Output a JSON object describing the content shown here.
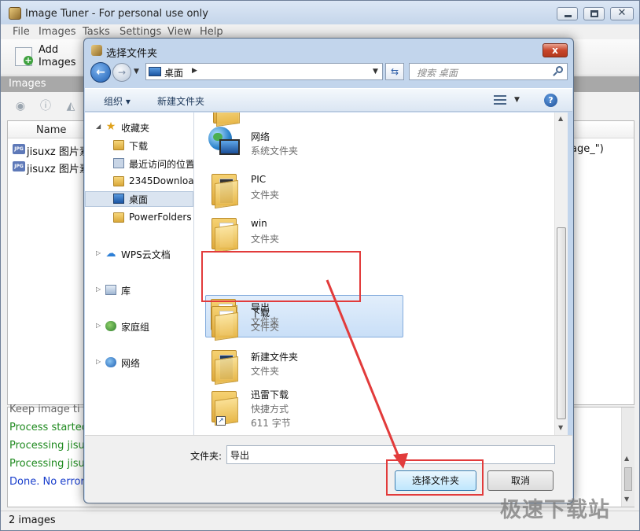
{
  "main_window": {
    "title": "Image Tuner - For personal use only",
    "menu": [
      "File",
      "Images",
      "Tasks",
      "Settings",
      "View",
      "Help"
    ],
    "toolbar": {
      "add_line1": "Add",
      "add_line2": "Images"
    },
    "images_header": "Images",
    "list": {
      "column_name": "Name",
      "rows": [
        {
          "name": "jisuxz 图片素材",
          "right_text": "age_\")"
        },
        {
          "name": "jisuxz 图片素材",
          "right_text": ""
        }
      ]
    },
    "log": [
      "Keep image ti",
      "Process started.",
      "Processing jisux",
      "Processing jisux",
      "Done. No errors"
    ],
    "status": "2 images"
  },
  "dialog": {
    "title": "选择文件夹",
    "close_glyph": "x",
    "address": "桌面",
    "search_placeholder": "搜索 桌面",
    "commands": {
      "organize": "组织 ▾",
      "new_folder": "新建文件夹"
    },
    "nav_pane": {
      "favorites": "收藏夹",
      "downloads": "下载",
      "recent": "最近访问的位置",
      "folder_2345": "2345Downloa",
      "desktop": "桌面",
      "powerfolders": "PowerFolders",
      "wps_cloud": "WPS云文档",
      "libraries": "库",
      "homegroup": "家庭组",
      "network": "网络"
    },
    "files": [
      {
        "name": "网络",
        "type": "系统文件夹",
        "icon": "network-icon"
      },
      {
        "name": "PIC",
        "type": "文件夹",
        "icon": "folder-icon"
      },
      {
        "name": "win",
        "type": "文件夹",
        "icon": "folder-icon"
      },
      {
        "name": "导出",
        "type": "文件夹",
        "icon": "folder-icon"
      },
      {
        "name": "下载",
        "type": "文件夹",
        "icon": "folder-icon"
      },
      {
        "name": "新建文件夹",
        "type": "文件夹",
        "icon": "folder-icon"
      },
      {
        "name": "迅雷下载",
        "type": "快捷方式",
        "size": "611 字节",
        "icon": "shortcut-folder-icon"
      }
    ],
    "selected_file": "导出",
    "folder_label": "文件夹:",
    "folder_value": "导出",
    "select_button": "选择文件夹",
    "cancel_button": "取消"
  },
  "watermark": "极速下载站",
  "colors": {
    "highlight": "#e23b3b",
    "dialog_frame": "#c2d5ec",
    "selection": "#c9dff7"
  }
}
